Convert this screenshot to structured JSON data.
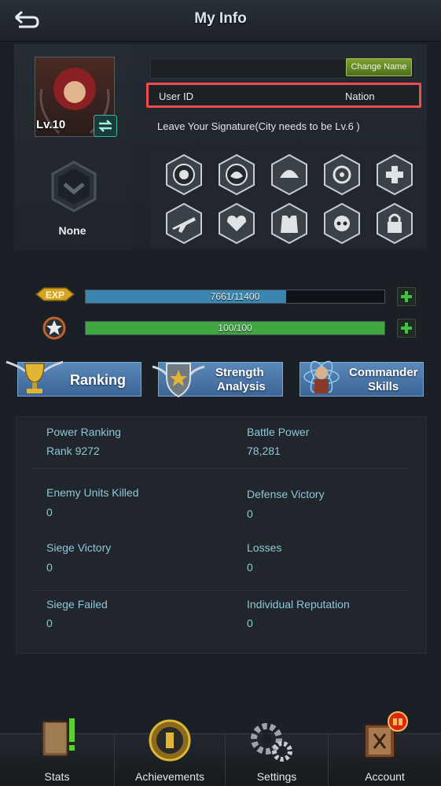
{
  "header": {
    "title": "My Info"
  },
  "profile": {
    "level": "Lv.10",
    "rank_title": "None",
    "change_name_label": "Change Name",
    "user_id_label": "User ID",
    "nation_label": "Nation",
    "signature_text": "Leave Your Signature(City needs to be Lv.6 )"
  },
  "medals": [
    "cerebrum-medal-icon",
    "brain-medal-icon",
    "helmet-medal-icon",
    "biohazard-medal-icon",
    "medic-cross-medal-icon",
    "rifle-medal-icon",
    "heart-medal-icon",
    "armor-vest-medal-icon",
    "skull-helmet-medal-icon",
    "lock-icon"
  ],
  "progress": {
    "exp": {
      "text": "7661/11400",
      "fraction": 0.672,
      "color": "#3a86b1"
    },
    "stamina": {
      "text": "100/100",
      "fraction": 1.0,
      "color": "#3fa73f"
    }
  },
  "actions": {
    "ranking": "Ranking",
    "strength_analysis_line1": "Strength",
    "strength_analysis_line2": "Analysis",
    "commander_skills_line1": "Commander",
    "commander_skills_line2": "Skills"
  },
  "stats": {
    "power_ranking_label": "Power Ranking",
    "power_ranking_value": "Rank 9272",
    "battle_power_label": "Battle Power",
    "battle_power_value": "78,281",
    "enemy_units_killed_label": "Enemy Units Killed",
    "enemy_units_killed_value": "0",
    "defense_victory_label": "Defense Victory",
    "defense_victory_value": "0",
    "siege_victory_label": "Siege Victory",
    "siege_victory_value": "0",
    "losses_label": "Losses",
    "losses_value": "0",
    "siege_failed_label": "Siege Failed",
    "siege_failed_value": "0",
    "individual_reputation_label": "Individual Reputation",
    "individual_reputation_value": "0"
  },
  "nav": {
    "stats": "Stats",
    "achievements": "Achievements",
    "settings": "Settings",
    "account": "Account"
  }
}
